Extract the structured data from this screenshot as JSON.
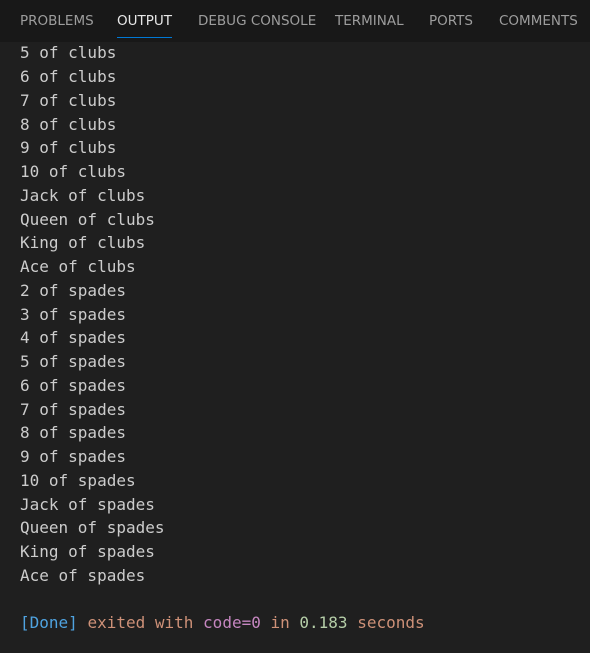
{
  "tabs": [
    {
      "label": "PROBLEMS",
      "active": false
    },
    {
      "label": "OUTPUT",
      "active": true
    },
    {
      "label": "DEBUG CONSOLE",
      "active": false
    },
    {
      "label": "TERMINAL",
      "active": false
    },
    {
      "label": "PORTS",
      "active": false
    },
    {
      "label": "COMMENTS",
      "active": false
    }
  ],
  "output": {
    "lines": [
      "5 of clubs",
      "6 of clubs",
      "7 of clubs",
      "8 of clubs",
      "9 of clubs",
      "10 of clubs",
      "Jack of clubs",
      "Queen of clubs",
      "King of clubs",
      "Ace of clubs",
      "2 of spades",
      "3 of spades",
      "4 of spades",
      "5 of spades",
      "6 of spades",
      "7 of spades",
      "8 of spades",
      "9 of spades",
      "10 of spades",
      "Jack of spades",
      "Queen of spades",
      "King of spades",
      "Ace of spades"
    ],
    "status": {
      "done": "[Done]",
      "exited_with": "exited with",
      "code": "code=0",
      "in": "in",
      "time": "0.183",
      "seconds": "seconds"
    }
  },
  "colors": {
    "background": "#1f1f1f",
    "tabbar": "#181818",
    "active_tab_underline": "#0078d4",
    "done": "#4fa3e0",
    "keyword_orange": "#ce9178",
    "code_purple": "#c586c0",
    "number_green": "#b5cea8"
  }
}
